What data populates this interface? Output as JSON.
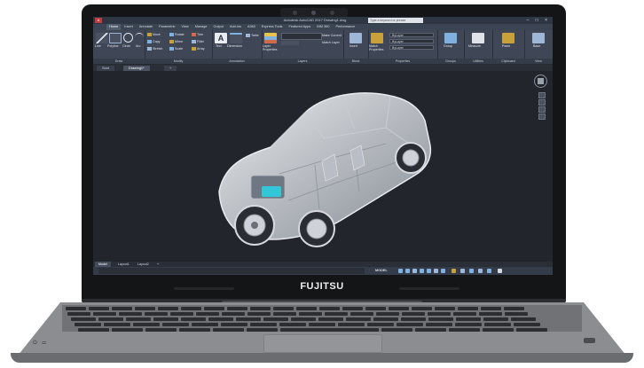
{
  "device": {
    "brand": "FUJITSU"
  },
  "app": {
    "title": "Autodesk AutoCAD 2017   Drawing1.dwg",
    "search_placeholder": "Type a keyword or phrase",
    "app_letter": "A",
    "window_controls": "– □ ×"
  },
  "ribbon_tabs": [
    "Home",
    "Insert",
    "Annotate",
    "Parametric",
    "View",
    "Manage",
    "Output",
    "Add-ins",
    "A360",
    "Express Tools",
    "Featured Apps",
    "BIM 360",
    "Performance"
  ],
  "ribbon_groups": {
    "draw": "Draw",
    "modify": "Modify",
    "annotation": "Annotation",
    "layers": "Layers",
    "block": "Block",
    "properties": "Properties",
    "groups": "Groups",
    "utilities": "Utilities",
    "clipboard": "Clipboard",
    "view": "View"
  },
  "draw_tools": {
    "line": "Line",
    "polyline": "Polyline",
    "circle": "Circle",
    "arc": "Arc"
  },
  "modify_tools": [
    "Move",
    "Rotate",
    "Trim",
    "Copy",
    "Mirror",
    "Fillet",
    "Stretch",
    "Scale",
    "Array"
  ],
  "annotation_tools": {
    "text": "Text",
    "dimension": "Dimension",
    "table": "Table"
  },
  "layer_tools": {
    "layer_properties": "Layer Properties",
    "make_current": "Make Current",
    "match_layer": "Match Layer"
  },
  "block_tools": {
    "insert": "Insert"
  },
  "properties_tools": {
    "match": "Match Properties",
    "bylayer": "ByLayer"
  },
  "groups_tools": {
    "group": "Group"
  },
  "utilities_tools": {
    "measure": "Measure"
  },
  "clipboard_tools": {
    "paste": "Paste"
  },
  "view_tools": {
    "base": "Base"
  },
  "doc_tabs": [
    "Start",
    "Drawing1*"
  ],
  "layout_tabs": [
    "Model",
    "Layout1",
    "Layout2"
  ],
  "status": {
    "model": "MODEL"
  },
  "colors": {
    "ribbon": "#3f4756",
    "viewport": "#22252b",
    "autocad_red": "#c23b3b",
    "accent_teal": "#32c7d6"
  }
}
